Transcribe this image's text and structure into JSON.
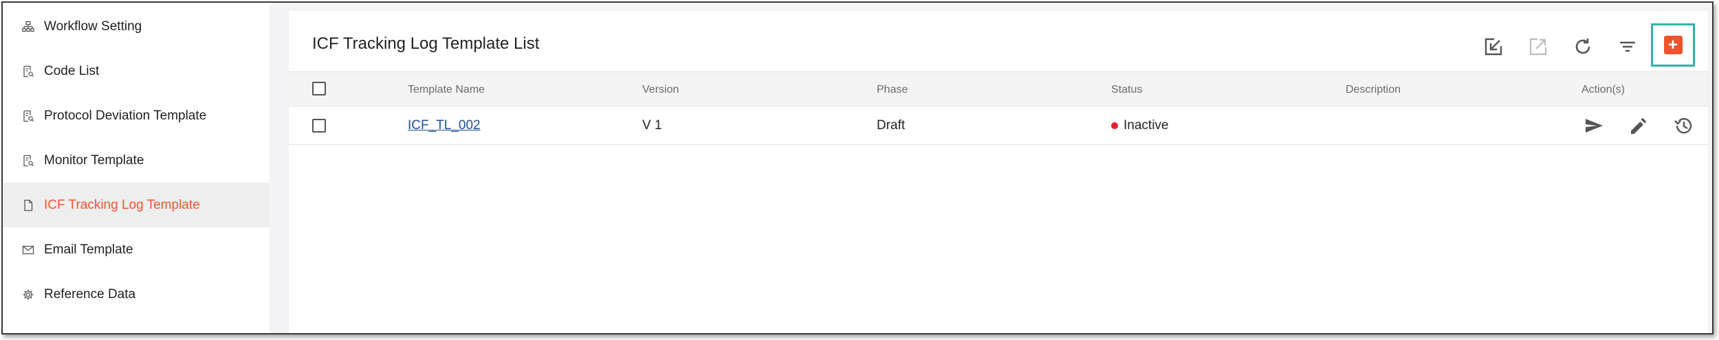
{
  "sidebar": {
    "items": [
      {
        "label": "Workflow Setting",
        "icon": "workflow-icon",
        "active": false
      },
      {
        "label": "Code List",
        "icon": "document-search-icon",
        "active": false
      },
      {
        "label": "Protocol Deviation Template",
        "icon": "document-search-icon",
        "active": false
      },
      {
        "label": "Monitor Template",
        "icon": "document-search-icon",
        "active": false
      },
      {
        "label": "ICF Tracking Log Template",
        "icon": "file-icon",
        "active": true
      },
      {
        "label": "Email Template",
        "icon": "mail-icon",
        "active": false
      },
      {
        "label": "Reference Data",
        "icon": "gear-icon",
        "active": false
      }
    ],
    "active_color": "#f0532c"
  },
  "main": {
    "title": "ICF Tracking Log Template List",
    "toolbar": {
      "icons": [
        "import-icon",
        "export-icon",
        "refresh-icon",
        "filter-icon",
        "add-icon"
      ],
      "add_color": "#f0532c",
      "highlight_color": "#2fb3a3"
    },
    "table": {
      "headers": {
        "template_name": "Template Name",
        "version": "Version",
        "phase": "Phase",
        "status": "Status",
        "description": "Description",
        "actions": "Action(s)"
      },
      "rows": [
        {
          "template_name": "ICF_TL_002",
          "version": "V 1",
          "phase": "Draft",
          "status": "Inactive",
          "status_color": "#e2222f",
          "description": "",
          "actions": [
            "send-icon",
            "edit-icon",
            "history-icon"
          ]
        }
      ]
    }
  }
}
